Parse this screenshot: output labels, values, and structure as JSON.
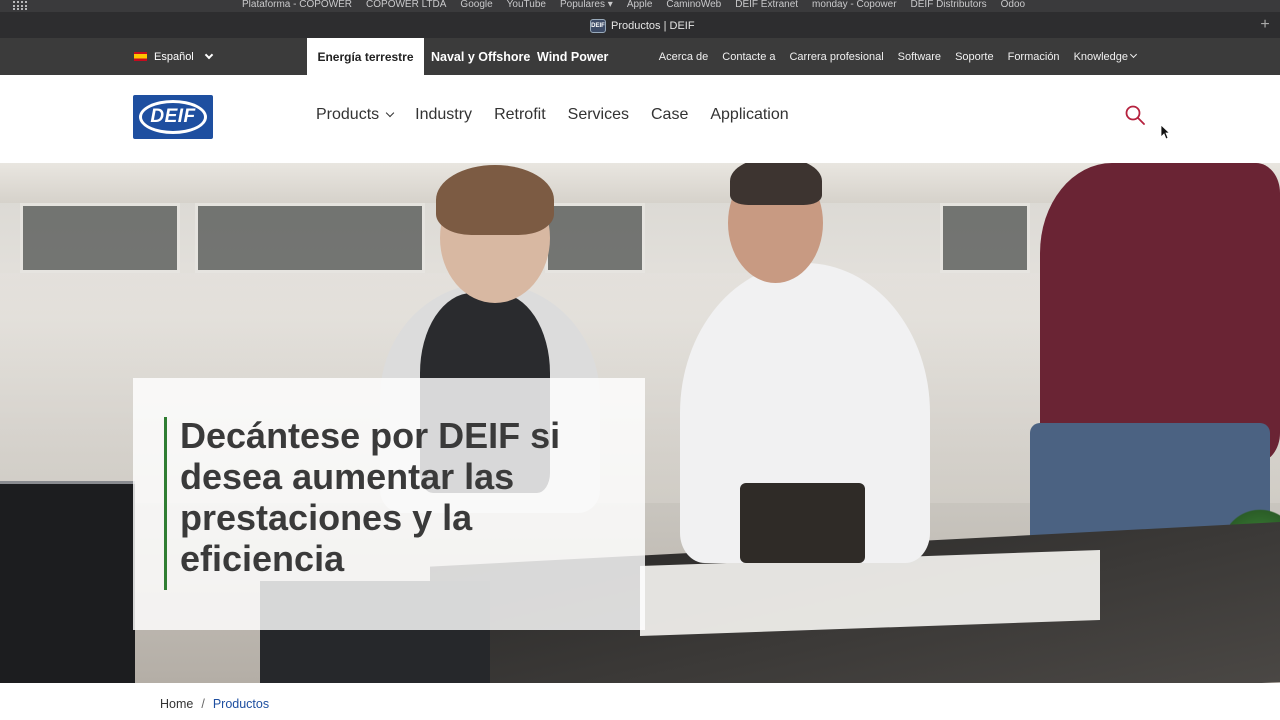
{
  "browser": {
    "bookmarks": [
      "Plataforma - COPOWER",
      "COPOWER LTDA",
      "Google",
      "YouTube",
      "Populares",
      "Apple",
      "CaminoWeb",
      "DEIF Extranet",
      "monday - Copower",
      "DEIF Distributors",
      "Odoo"
    ],
    "tab_title": "Productos | DEIF"
  },
  "topbar": {
    "language": "Español",
    "segments": {
      "active": "Energía terrestre",
      "naval": "Naval y Offshore",
      "wind": "Wind Power"
    },
    "utility_links": [
      "Acerca de",
      "Contacte a",
      "Carrera profesional",
      "Software",
      "Soporte",
      "Formación",
      "Knowledge"
    ]
  },
  "header": {
    "logo_text": "DEIF",
    "nav": [
      "Products",
      "Industry",
      "Retrofit",
      "Services",
      "Case",
      "Application"
    ]
  },
  "hero": {
    "title": "Decántese por DEIF si desea aumentar las prestaciones y la eficiencia"
  },
  "breadcrumb": {
    "home": "Home",
    "separator": "/",
    "current": "Productos"
  },
  "colors": {
    "brand_blue": "#1e4fa0",
    "accent_green": "#2f7d32",
    "search_red": "#b5213e",
    "topbar": "#3b3b3b"
  }
}
